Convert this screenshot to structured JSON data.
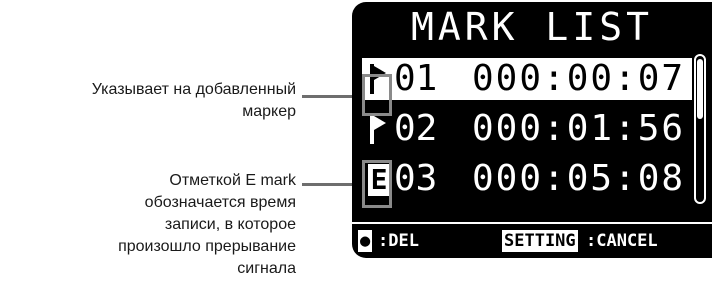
{
  "callouts": {
    "marker_note": [
      "Указывает на добавленный",
      "маркер"
    ],
    "emark_note": [
      "Отметкой E mark",
      "обозначается время",
      "записи, в которое",
      "произошло прерывание",
      "сигнала"
    ]
  },
  "screen": {
    "title": "MARK LIST",
    "marks": [
      {
        "number": "01",
        "time": "000:00:07",
        "type": "flag-icon",
        "selected": true
      },
      {
        "number": "02",
        "time": "000:01:56",
        "type": "flag-icon",
        "selected": false
      },
      {
        "number": "03",
        "time": "000:05:08",
        "type": "e-mark-icon",
        "e_label": "E",
        "selected": false
      }
    ],
    "bottom_bar": {
      "del_key": "●",
      "del_label": ":DEL",
      "setting_key": "SETTING",
      "cancel_label": ":CANCEL"
    }
  },
  "colors": {
    "screen_bg": "#000000",
    "screen_fg": "#ffffff",
    "leader": "#6e6e6e",
    "highlight": "#8a8a8a"
  }
}
